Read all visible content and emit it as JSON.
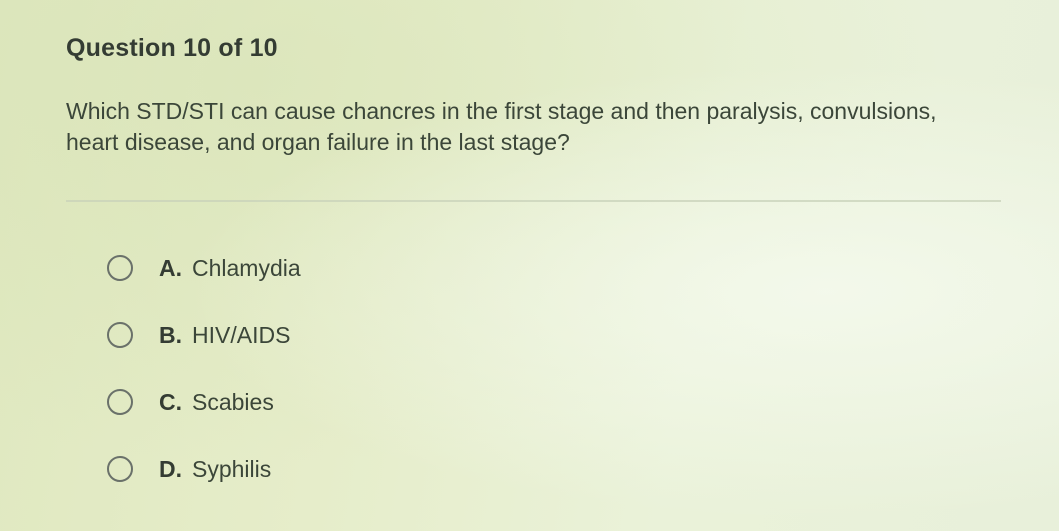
{
  "question": {
    "title": "Question 10 of 10",
    "text": "Which STD/STI can cause chancres in the first stage and then paralysis, convulsions, heart disease, and organ failure in the last stage?"
  },
  "options": [
    {
      "letter": "A.",
      "label": "Chlamydia",
      "selected": false
    },
    {
      "letter": "B.",
      "label": "HIV/AIDS",
      "selected": false
    },
    {
      "letter": "C.",
      "label": "Scabies",
      "selected": false
    },
    {
      "letter": "D.",
      "label": "Syphilis",
      "selected": false
    }
  ]
}
